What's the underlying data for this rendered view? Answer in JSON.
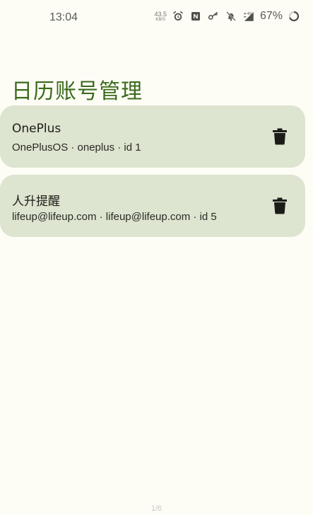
{
  "status_bar": {
    "time": "13:04",
    "net_speed_value": "43.5",
    "net_speed_unit": "KB/S",
    "battery_percent": "67%",
    "icons": [
      "alarm-icon",
      "nfc-icon",
      "vpn-key-icon",
      "bell-off-icon",
      "signal-4g-icon",
      "battery-ring-icon"
    ]
  },
  "header": {
    "title": "日历账号管理"
  },
  "accounts": [
    {
      "name": "OnePlus",
      "detail": "OnePlusOS · oneplus · id 1",
      "action_icon": "trash-icon"
    },
    {
      "name": "人升提醒",
      "detail": "lifeup@lifeup.com · lifeup@lifeup.com · id 5",
      "action_icon": "trash-icon"
    }
  ],
  "footer": {
    "page_indicator": "1/6"
  },
  "colors": {
    "background": "#fdfdf6",
    "title": "#3b6a1b",
    "card": "#dde4cf",
    "icon": "#1b1c18"
  }
}
